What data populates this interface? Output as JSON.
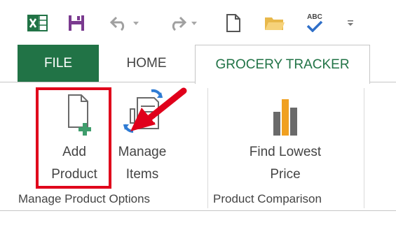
{
  "colors": {
    "excel_green": "#217346",
    "annotation_red": "#e0001b"
  },
  "quick_access": {
    "icons": [
      "excel-logo-icon",
      "save-icon",
      "undo-icon",
      "dropdown-arrow-icon",
      "redo-icon",
      "dropdown-arrow-icon",
      "new-document-icon",
      "open-folder-icon",
      "spelling-check-icon",
      "customize-toolbar-icon"
    ],
    "spelling_text": "ABC"
  },
  "tabs": {
    "file": "FILE",
    "home": "HOME",
    "grocery_tracker": "GROCERY TRACKER"
  },
  "ribbon": {
    "groups": {
      "manage_product_options": {
        "label": "Manage Product Options",
        "add_product": {
          "line1": "Add",
          "line2": "Product",
          "icon": "new-page-plus-icon"
        },
        "manage_items": {
          "line1": "Manage",
          "line2": "Items",
          "icon": "refresh-list-icon"
        }
      },
      "product_comparison": {
        "label": "Product Comparison",
        "find_lowest_price": {
          "line1": "Find Lowest",
          "line2": "Price",
          "icon": "bar-chart-icon"
        }
      }
    }
  },
  "annotations": {
    "highlight_target": "add-product-button",
    "arrow_target": "manage-items-button"
  }
}
